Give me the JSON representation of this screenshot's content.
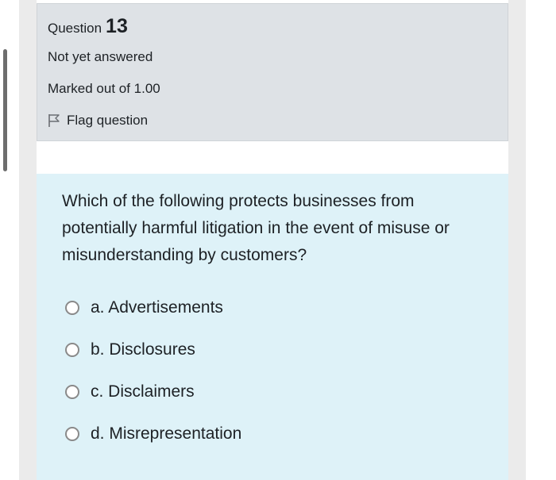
{
  "question_info": {
    "label": "Question",
    "number": "13",
    "state": "Not yet answered",
    "grade": "Marked out of 1.00",
    "flag_label": "Flag question",
    "flag_icon": "flag-outline-icon"
  },
  "question": {
    "text": "Which of the following protects businesses from potentially harmful litigation in the event of misuse or misunderstanding by customers?",
    "answers": [
      {
        "letter": "a.",
        "label": "a. Advertisements"
      },
      {
        "letter": "b.",
        "label": "b. Disclosures"
      },
      {
        "letter": "c.",
        "label": "c. Disclaimers"
      },
      {
        "letter": "d.",
        "label": "d. Misrepresentation"
      }
    ]
  },
  "colors": {
    "info_background": "#dee2e6",
    "question_background": "#def2f8",
    "text": "#1d2125"
  }
}
